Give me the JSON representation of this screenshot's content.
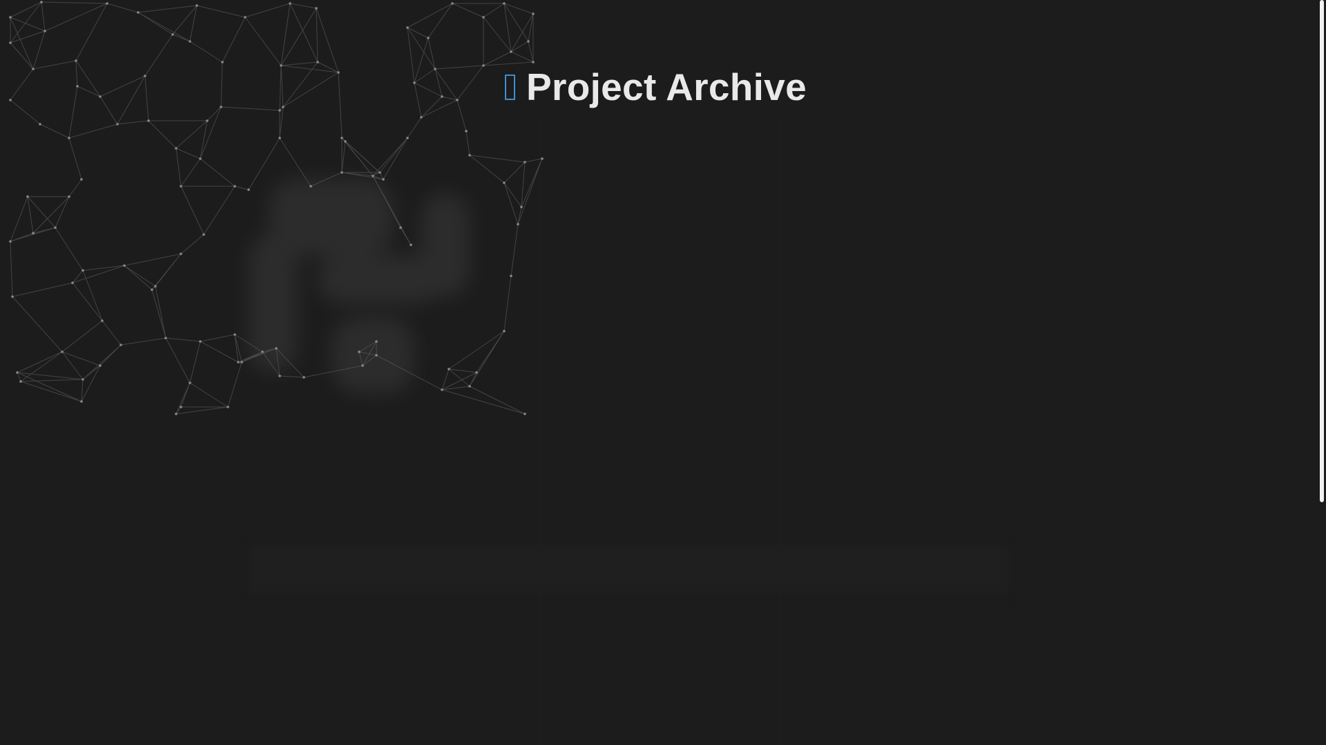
{
  "header": {
    "title": "Project Archive",
    "title_icon": "missing-glyph-icon"
  },
  "colors": {
    "background": "#1c1c1c",
    "accent": "#3d8fd6",
    "title_text": "#e9e9e9",
    "network_line": "#5a5a5a",
    "network_node": "#8a8a8a",
    "scrollbar_thumb": "#f1f1f1"
  },
  "background": {
    "decoration": "particle-network"
  }
}
